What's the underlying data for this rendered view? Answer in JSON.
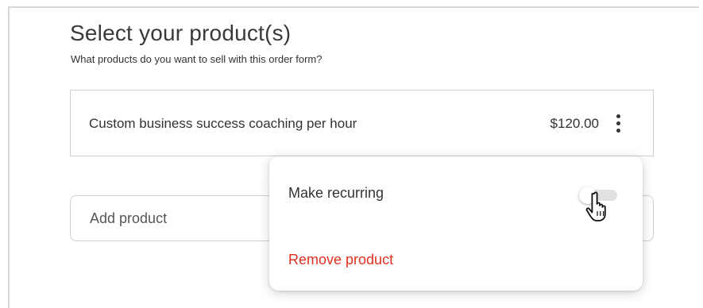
{
  "header": {
    "title": "Select your product(s)",
    "subtitle": "What products do you want to sell with this order form?"
  },
  "product": {
    "name": "Custom business success coaching per hour",
    "price": "$120.00",
    "menu_icon": "more-vertical-icon"
  },
  "add_product": {
    "placeholder": "Add product"
  },
  "context_menu": {
    "make_recurring_label": "Make recurring",
    "recurring_enabled": false,
    "remove_label": "Remove product"
  },
  "colors": {
    "danger": "#e0301e",
    "toggle_track": "#e1e1e1",
    "border": "#cfcfcf"
  }
}
